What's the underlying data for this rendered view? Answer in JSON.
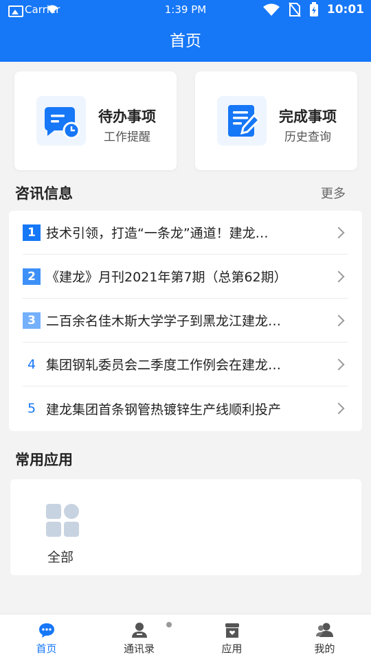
{
  "status_bar": {
    "carrier": "Carrier",
    "time": "1:39 PM",
    "clock": "10:01"
  },
  "header": {
    "title": "首页"
  },
  "quick_cards": [
    {
      "title": "待办事项",
      "subtitle": "工作提醒",
      "icon": "todo-chat-clock-icon"
    },
    {
      "title": "完成事项",
      "subtitle": "历史查询",
      "icon": "done-document-pen-icon"
    }
  ],
  "news": {
    "section_title": "咨讯信息",
    "more_label": "更多",
    "items": [
      {
        "rank": "1",
        "text": "技术引领，打造“一条龙”通道！建龙…"
      },
      {
        "rank": "2",
        "text": "《建龙》月刊2021年第7期（总第62期）"
      },
      {
        "rank": "3",
        "text": "二百余名佳木斯大学学子到黑龙江建龙…"
      },
      {
        "rank": "4",
        "text": "集团钢轧委员会二季度工作例会在建龙…"
      },
      {
        "rank": "5",
        "text": "建龙集团首条钢管热镀锌生产线顺利投产"
      }
    ]
  },
  "apps": {
    "section_title": "常用应用",
    "items": [
      {
        "label": "全部",
        "icon": "grid-all-icon"
      }
    ]
  },
  "tabbar": {
    "tabs": [
      {
        "label": "首页",
        "icon": "chat-bubble-icon",
        "active": true
      },
      {
        "label": "通讯录",
        "icon": "contact-person-icon",
        "active": false
      },
      {
        "label": "应用",
        "icon": "store-icon",
        "active": false
      },
      {
        "label": "我的",
        "icon": "profile-people-icon",
        "active": false
      }
    ]
  },
  "colors": {
    "primary": "#1677f7",
    "background": "#f3f3f4",
    "inactive_tab": "#333333"
  }
}
